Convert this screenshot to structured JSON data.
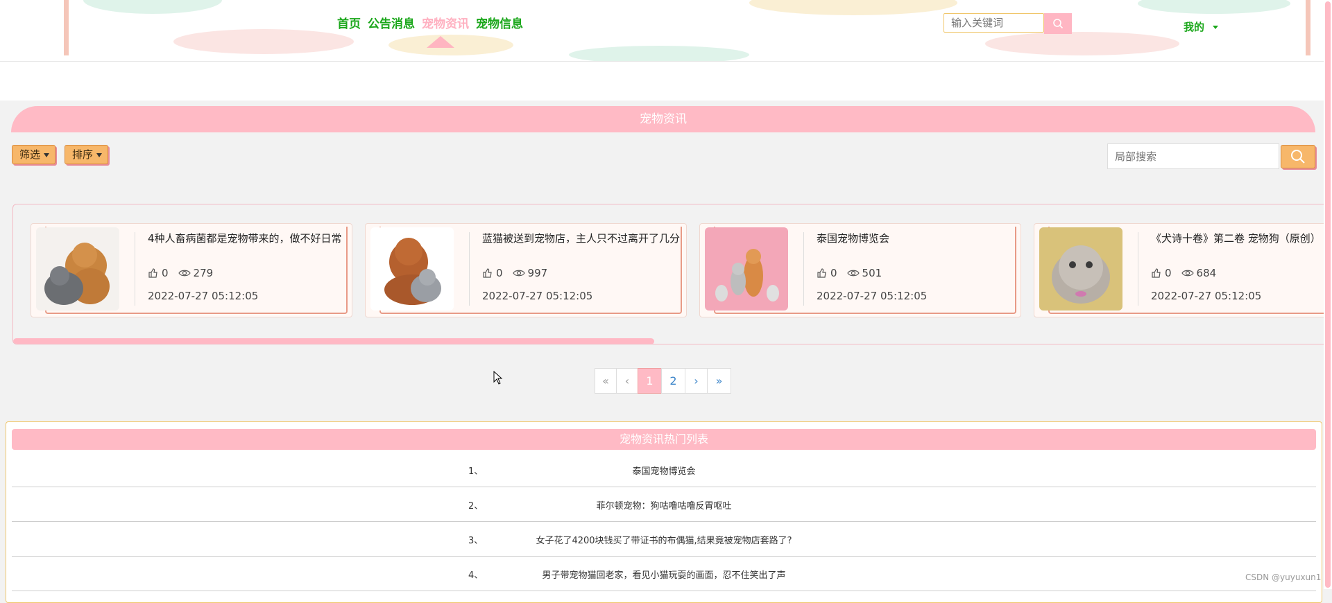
{
  "nav": {
    "items": [
      {
        "label": "首页",
        "active": false
      },
      {
        "label": "公告消息",
        "active": false
      },
      {
        "label": "宠物资讯",
        "active": true
      },
      {
        "label": "宠物信息",
        "active": false
      }
    ],
    "search_placeholder": "输入关键词",
    "user_menu": "我的",
    "colors": {
      "nav_text": "#1ba71b",
      "active": "#ffb0c0",
      "accent_pink": "#ffbac5"
    }
  },
  "section": {
    "title": "宠物资讯",
    "filter_label": "筛选",
    "sort_label": "排序",
    "local_search_placeholder": "局部搜索"
  },
  "cards": [
    {
      "title": "4种人畜病菌都是宠物带来的，做不好日常",
      "likes": "0",
      "views": "279",
      "date": "2022-07-27 05:12:05",
      "image": "poodle-and-cat-photo"
    },
    {
      "title": "蓝猫被送到宠物店，主人只不过离开了几分",
      "likes": "0",
      "views": "997",
      "date": "2022-07-27 05:12:05",
      "image": "puppy-and-kitten-photo"
    },
    {
      "title": "泰国宠物博览会",
      "likes": "0",
      "views": "501",
      "date": "2022-07-27 05:12:05",
      "image": "dogs-and-cats-pink-background-photo"
    },
    {
      "title": "《犬诗十卷》第二卷 宠物狗（原创）",
      "likes": "0",
      "views": "684",
      "date": "2022-07-27 05:12:05",
      "image": "grey-kitten-photo"
    }
  ],
  "pagination": {
    "first": "«",
    "prev": "‹",
    "pages": [
      "1",
      "2"
    ],
    "current": "1",
    "next": "›",
    "last": "»"
  },
  "hot_list": {
    "title": "宠物资讯热门列表",
    "items": [
      {
        "index": "1、",
        "title": "泰国宠物博览会"
      },
      {
        "index": "2、",
        "title": "菲尔顿宠物：狗咕噜咕噜反胃呕吐"
      },
      {
        "index": "3、",
        "title": "女子花了4200块钱买了带证书的布偶猫,结果竟被宠物店套路了?"
      },
      {
        "index": "4、",
        "title": "男子带宠物猫回老家，看见小猫玩耍的画面，忍不住笑出了声"
      }
    ]
  },
  "watermark": "CSDN @yuyuxun1"
}
